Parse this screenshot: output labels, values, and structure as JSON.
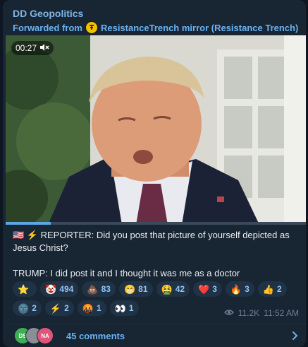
{
  "post": {
    "channel_name": "DD Geopolitics",
    "forwarded_from": "Forwarded from",
    "forward_source": "ResistanceTrench mirror (Resistance Trench)"
  },
  "video": {
    "duration": "00:27",
    "muted": true,
    "progress": 0.15
  },
  "caption": {
    "line1": "🇺🇸 ⚡ REPORTER: Did you post that picture of yourself depicted as Jesus Christ?",
    "line2": "TRUMP:  I did post it and I thought it was me as a doctor"
  },
  "reactions": [
    {
      "emoji": "⭐",
      "count": ""
    },
    {
      "emoji": "🤡",
      "count": "494"
    },
    {
      "emoji": "💩",
      "count": "83"
    },
    {
      "emoji": "😁",
      "count": "81"
    },
    {
      "emoji": "🤮",
      "count": "42"
    },
    {
      "emoji": "❤️",
      "count": "3"
    },
    {
      "emoji": "🔥",
      "count": "3"
    },
    {
      "emoji": "👍",
      "count": "2"
    },
    {
      "emoji": "🌚",
      "count": "2"
    },
    {
      "emoji": "⚡",
      "count": "2"
    },
    {
      "emoji": "🤬",
      "count": "1"
    },
    {
      "emoji": "👀",
      "count": "1"
    }
  ],
  "meta": {
    "views": "11.2K",
    "time": "11:52 AM"
  },
  "comments": {
    "label": "45 comments",
    "avatars": [
      {
        "initials": "DS",
        "color": "#3fae55"
      },
      {
        "initials": "",
        "color": "#8a8f96"
      },
      {
        "initials": "NA",
        "color": "#e0557a"
      }
    ]
  },
  "colors": {
    "background": "#0e1621",
    "bubble": "#182533",
    "accent": "#6ab3f3",
    "reaction_pill": "#203246"
  }
}
